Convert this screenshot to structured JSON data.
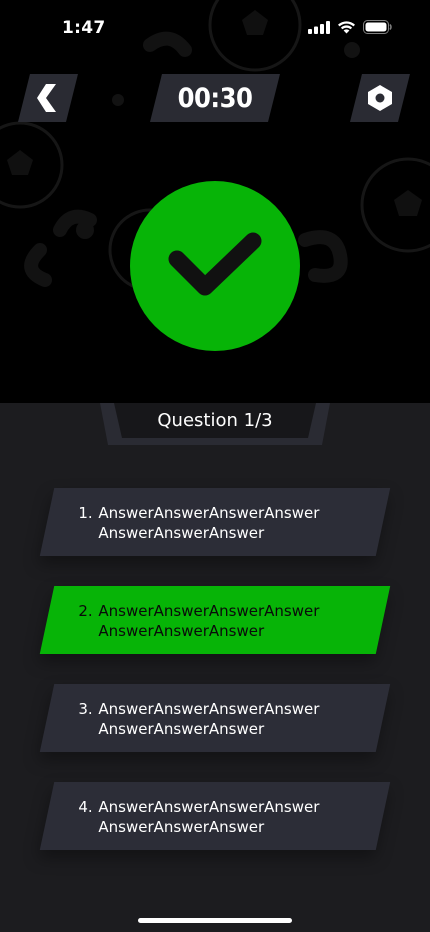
{
  "status_bar": {
    "time": "1:47"
  },
  "header": {
    "timer": "00:30"
  },
  "result": {
    "state": "correct",
    "color": "#07b407"
  },
  "question": {
    "label": "Question 1/3"
  },
  "answers": [
    {
      "number": "1.",
      "text": "AnswerAnswerAnswerAnswer AnswerAnswerAnswer",
      "selected": false
    },
    {
      "number": "2.",
      "text": "AnswerAnswerAnswerAnswer AnswerAnswerAnswer",
      "selected": true
    },
    {
      "number": "3.",
      "text": "AnswerAnswerAnswerAnswer AnswerAnswerAnswer",
      "selected": false
    },
    {
      "number": "4.",
      "text": "AnswerAnswerAnswerAnswer AnswerAnswerAnswer",
      "selected": false
    }
  ],
  "icons": {
    "back": "chevron-left-icon",
    "settings": "hexagon-settings-icon",
    "result": "checkmark-icon",
    "background": "soccer-ball-icon"
  },
  "colors": {
    "accent": "#07b407",
    "panel": "#2c2d37",
    "background_top": "#000000",
    "background_bottom": "#1c1c1f"
  }
}
